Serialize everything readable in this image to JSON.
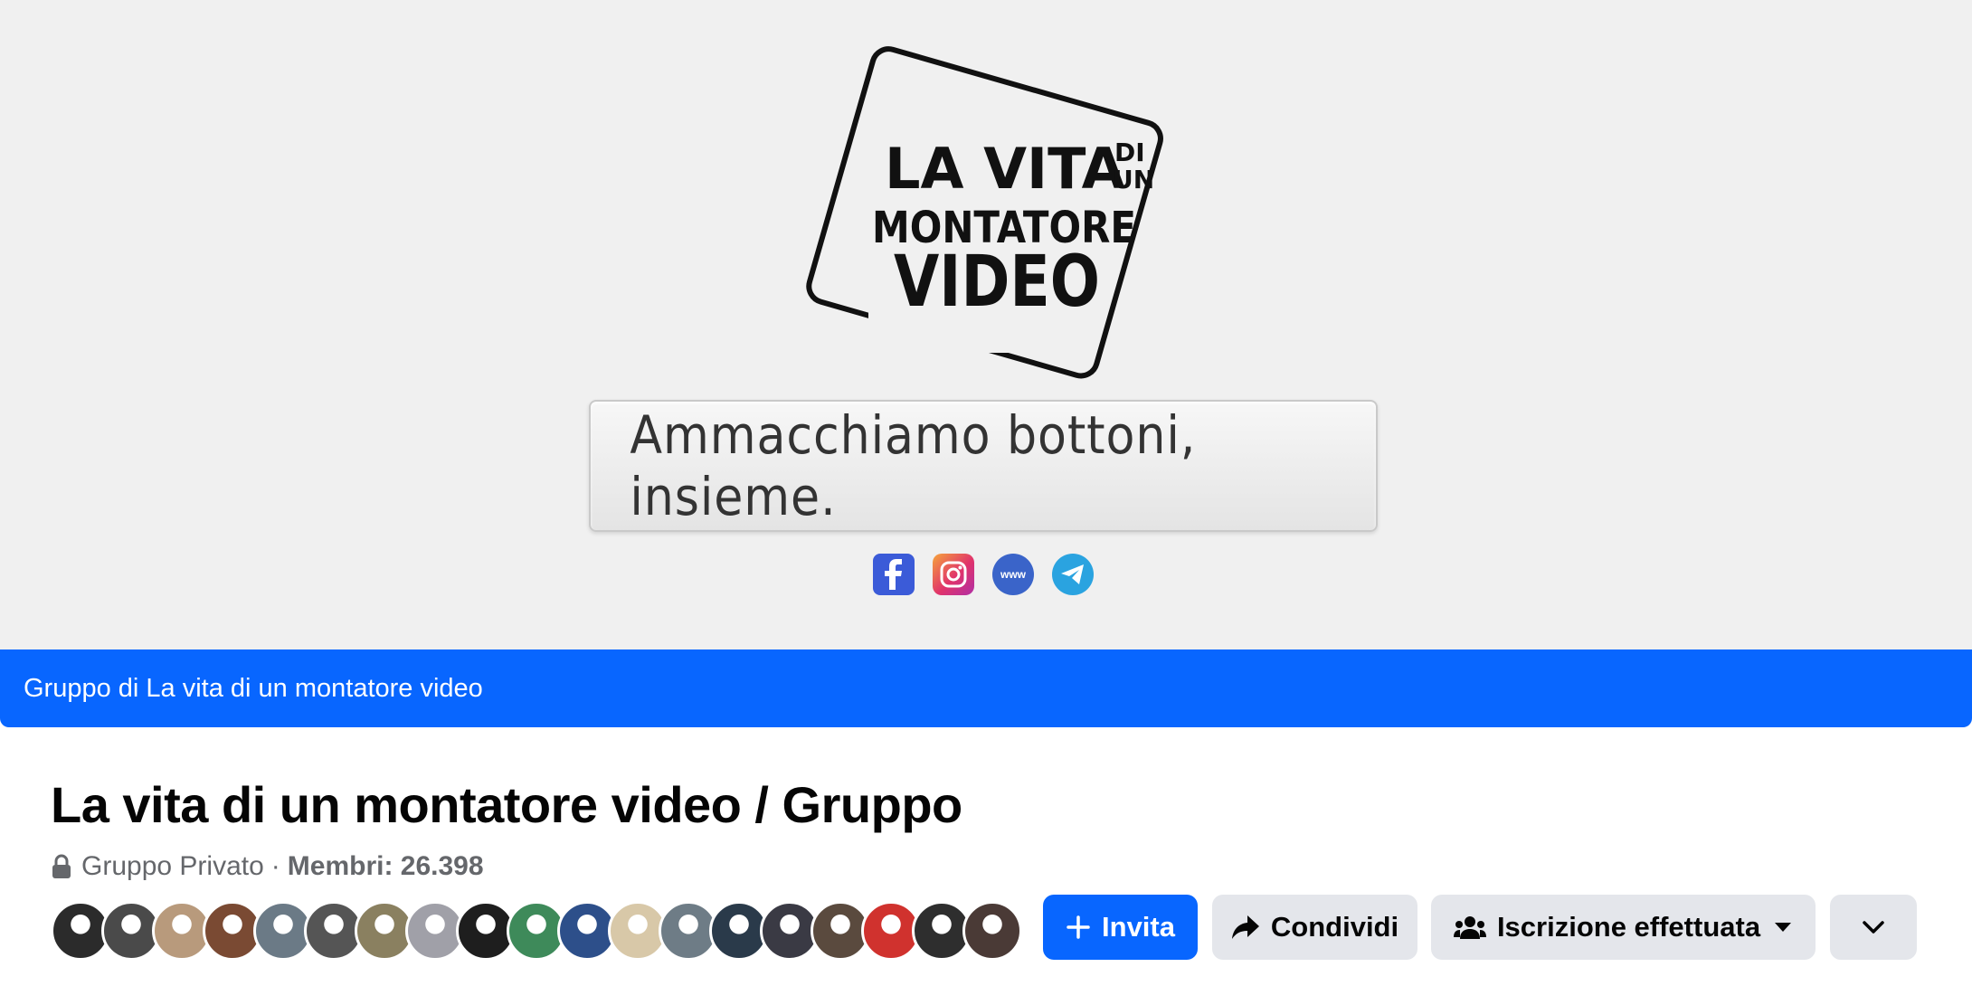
{
  "cover": {
    "logo": {
      "line1": "LA VITA",
      "small1": "DI",
      "small2": "UN",
      "line2": "MONTATORE",
      "line3": "VIDEO"
    },
    "tagline": "Ammacchiamo bottoni, insieme.",
    "social_icons": [
      "facebook-icon",
      "instagram-icon",
      "website-icon",
      "telegram-icon"
    ],
    "www_label": "www"
  },
  "group_bar": {
    "text": "Gruppo di La vita di un montatore video",
    "color": "#0866ff"
  },
  "header": {
    "title": "La vita di un montatore video / Gruppo",
    "privacy": "Gruppo Privato",
    "separator": "·",
    "members": "Membri: 26.398"
  },
  "members_preview": {
    "avatar_colors": [
      "#2b2b2b",
      "#4a4a4a",
      "#b89a7c",
      "#7a4a33",
      "#6b7a86",
      "#555555",
      "#8a8060",
      "#a0a0a8",
      "#1e1e1e",
      "#3e8a5a",
      "#2d4f8a",
      "#d8c8a8",
      "#6e7c86",
      "#2a3a4a",
      "#3a3a44",
      "#5a4a3e",
      "#d0322e",
      "#2e2e2e",
      "#4a3a36"
    ]
  },
  "actions": {
    "invite_label": "Invita",
    "share_label": "Condividi",
    "joined_label": "Iscrizione effettuata"
  }
}
